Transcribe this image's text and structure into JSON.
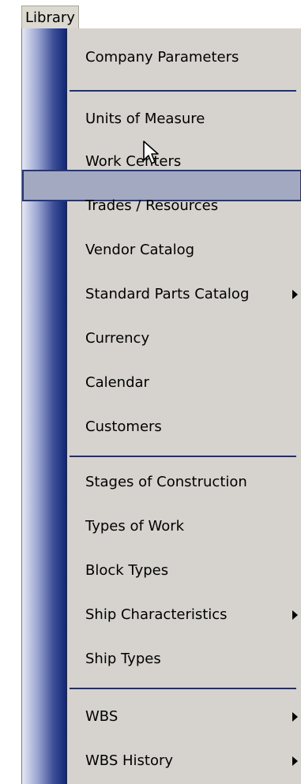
{
  "menubar": {
    "title": "Library"
  },
  "menu": {
    "items": [
      {
        "label": "Company Parameters"
      },
      {
        "label": "Units of Measure"
      },
      {
        "label": "Work Centers",
        "highlighted": true
      },
      {
        "label": "Trades / Resources"
      },
      {
        "label": "Vendor Catalog"
      },
      {
        "label": "Standard Parts Catalog",
        "submenu": true
      },
      {
        "label": "Currency"
      },
      {
        "label": "Calendar"
      },
      {
        "label": "Customers"
      },
      {
        "label": "Stages of Construction"
      },
      {
        "label": "Types of Work"
      },
      {
        "label": "Block Types"
      },
      {
        "label": "Ship Characteristics",
        "submenu": true
      },
      {
        "label": "Ship Types"
      },
      {
        "label": "WBS",
        "submenu": true
      },
      {
        "label": "WBS History",
        "submenu": true
      }
    ]
  },
  "icons": {
    "submenu": "chevron-right-icon",
    "cursor": "mouse-pointer-icon"
  },
  "colors": {
    "menu_background": "#d6d3ce",
    "highlight_fill": "#a4a9c2",
    "highlight_border": "#24367a",
    "separator": "#1e2f79",
    "gradient_dark": "#0e2474"
  }
}
